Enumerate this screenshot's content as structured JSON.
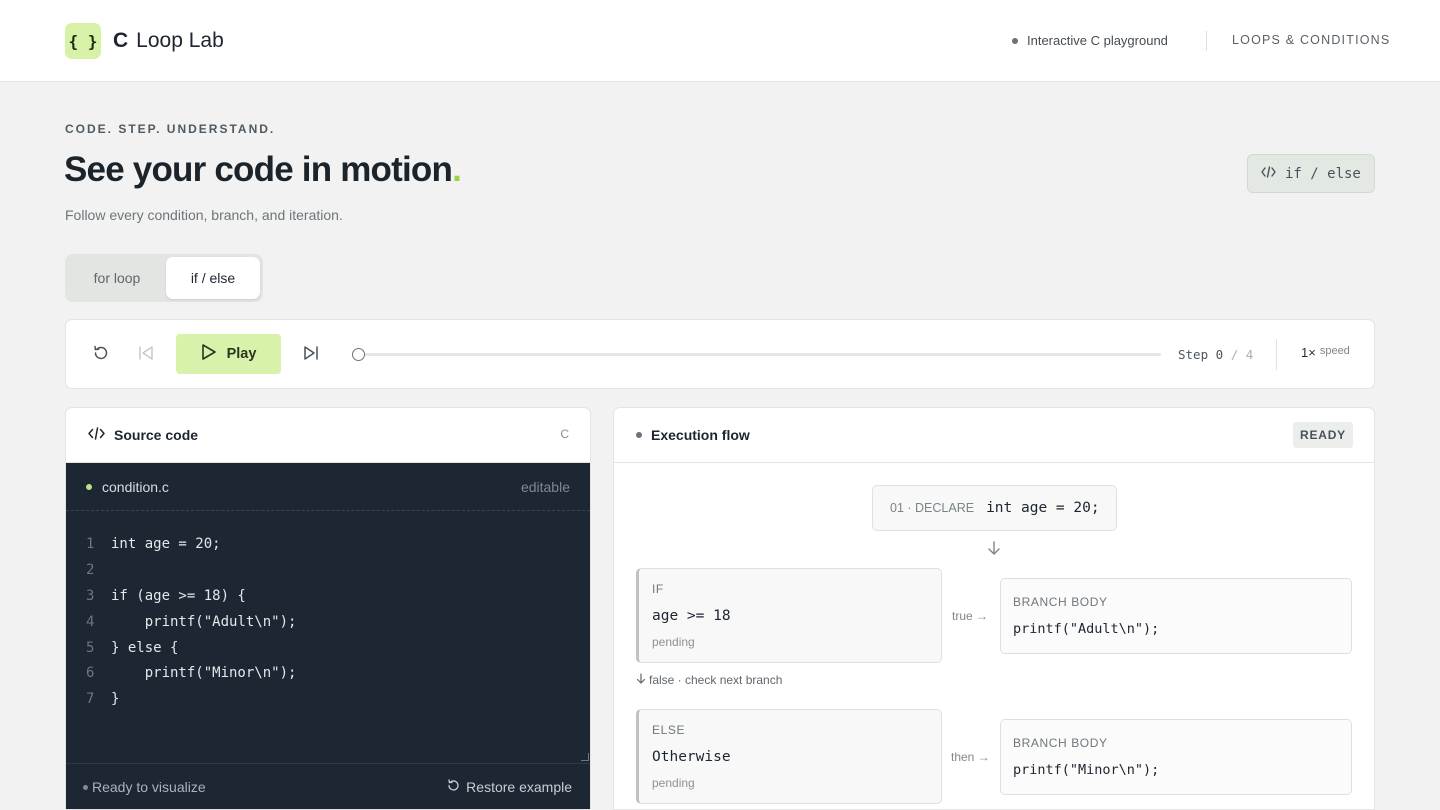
{
  "header": {
    "logo_glyph": "{ }",
    "brand_bold": "C",
    "brand_rest": "Loop Lab",
    "status_text": "Interactive C playground",
    "section_tag": "LOOPS & CONDITIONS"
  },
  "hero": {
    "eyebrow": "CODE. STEP. UNDERSTAND.",
    "title": "See your code in motion",
    "title_accent": ".",
    "subtitle": "Follow every condition, branch, and iteration.",
    "mode_badge": "if / else"
  },
  "tabs": [
    {
      "label": "for loop",
      "active": false
    },
    {
      "label": "if / else",
      "active": true
    }
  ],
  "controls": {
    "play_label": "Play",
    "step_prefix": "Step",
    "step_current": "0",
    "step_sep": "/",
    "step_total": "4",
    "progress": 0,
    "speed_value": "1×",
    "speed_label": "speed"
  },
  "source": {
    "title": "Source code",
    "language": "C",
    "file_name": "condition.c",
    "file_mode": "editable",
    "lines": [
      {
        "n": "1",
        "text": "int age = 20;"
      },
      {
        "n": "2",
        "text": ""
      },
      {
        "n": "3",
        "text": "if (age >= 18) {"
      },
      {
        "n": "4",
        "text": "    printf(\"Adult\\n\");"
      },
      {
        "n": "5",
        "text": "} else {"
      },
      {
        "n": "6",
        "text": "    printf(\"Minor\\n\");"
      },
      {
        "n": "7",
        "text": "}"
      }
    ],
    "footer_status": "Ready to visualize",
    "restore_label": "Restore example"
  },
  "flow": {
    "title": "Execution flow",
    "status": "READY",
    "declare": {
      "kind": "01 · DECLARE",
      "code": "int age = 20;"
    },
    "if_node": {
      "kind": "IF",
      "expr": "age >= 18",
      "state": "pending",
      "edge": "true →"
    },
    "if_body": {
      "kind": "BRANCH BODY",
      "code": "printf(\"Adult\\n\");"
    },
    "false_note": "false · check next branch",
    "else_node": {
      "kind": "ELSE",
      "expr": "Otherwise",
      "state": "pending",
      "edge": "then →"
    },
    "else_body": {
      "kind": "BRANCH BODY",
      "code": "printf(\"Minor\\n\");"
    }
  },
  "colors": {
    "accent": "#d9f2ab",
    "title_dot": "#9cd245",
    "editor_bg": "#1c2733"
  }
}
